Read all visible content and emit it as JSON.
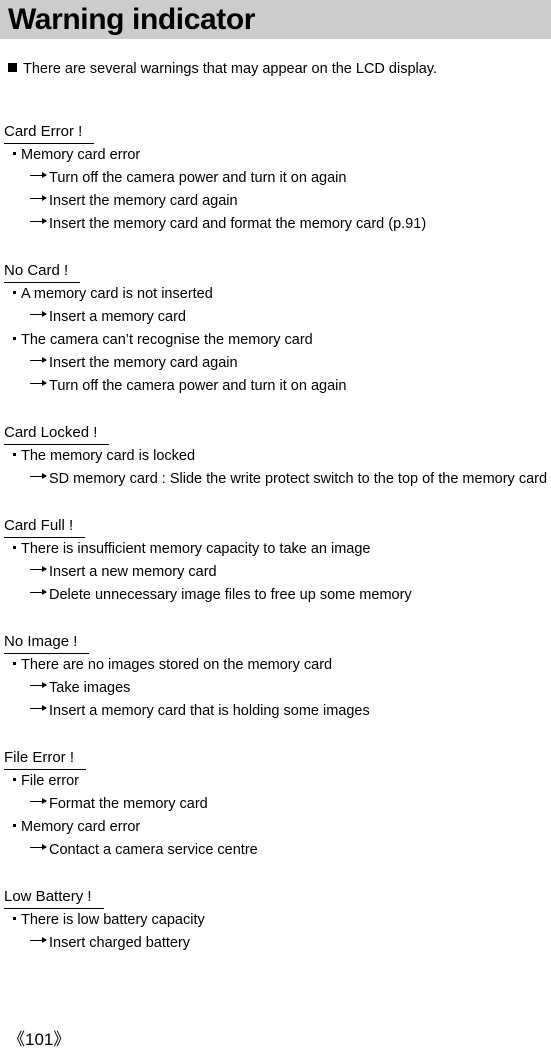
{
  "header": {
    "title": "Warning indicator",
    "band_color": "#cccccc"
  },
  "intro": {
    "bullet_icon": "filled-square-bullet",
    "text": "There are several warnings that may appear on the LCD display."
  },
  "bullets": {
    "cause_icon": "middot-bullet",
    "fix_icon": "long-right-arrow-icon"
  },
  "sections": [
    {
      "heading": "Card Error !",
      "causes": [
        {
          "text": "Memory card error",
          "fixes": [
            "Turn off the camera power and turn it on again",
            "Insert the memory card again",
            "Insert the memory card and format the memory card (p.91)"
          ]
        }
      ]
    },
    {
      "heading": "No Card !",
      "causes": [
        {
          "text": "A memory card is not inserted",
          "fixes": [
            "Insert a memory card"
          ]
        },
        {
          "text": "The camera can’t recognise the memory card",
          "fixes": [
            "Insert the memory card again",
            "Turn off the camera power and turn it on again"
          ]
        }
      ]
    },
    {
      "heading": "Card Locked !",
      "causes": [
        {
          "text": "The memory card is locked",
          "fixes": [
            "SD memory card : Slide the write protect switch to the top of the memory card"
          ]
        }
      ]
    },
    {
      "heading": "Card Full !",
      "causes": [
        {
          "text": "There is insufficient memory capacity to take an image",
          "fixes": [
            "Insert a new memory card",
            "Delete unnecessary image files to free up some memory"
          ]
        }
      ]
    },
    {
      "heading": "No Image !",
      "causes": [
        {
          "text": "There are no images stored on the memory card",
          "fixes": [
            "Take images",
            "Insert a memory card that is holding some images"
          ]
        }
      ]
    },
    {
      "heading": "File Error !",
      "causes": [
        {
          "text": "File error",
          "fixes": [
            "Format the memory card"
          ]
        },
        {
          "text": "Memory card error",
          "fixes": [
            "Contact a camera service centre"
          ]
        }
      ]
    },
    {
      "heading": "Low Battery !",
      "causes": [
        {
          "text": "There is low battery capacity",
          "fixes": [
            "Insert charged battery"
          ]
        }
      ]
    }
  ],
  "footer": {
    "page_number": "《101》"
  }
}
